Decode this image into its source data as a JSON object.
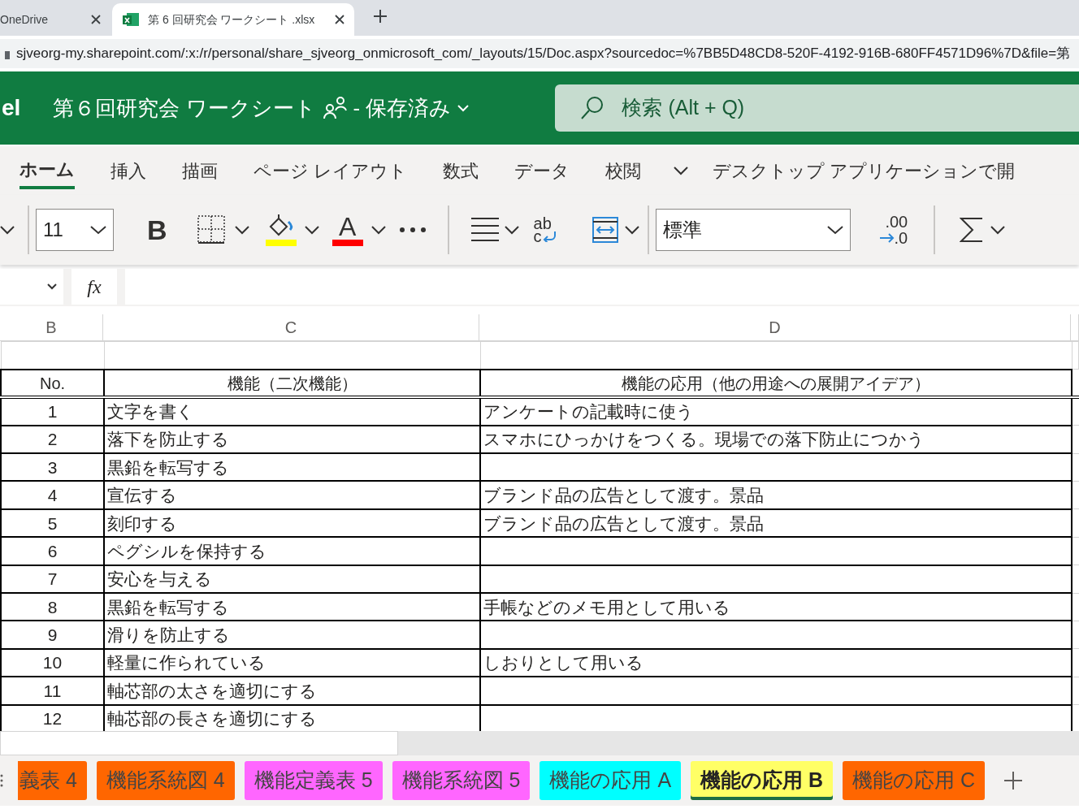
{
  "browser_tabs": [
    {
      "title": "OneDrive",
      "selected": false
    },
    {
      "title": "第 6 回研究会 ワークシート .xlsx",
      "selected": true
    }
  ],
  "address": "sjveorg-my.sharepoint.com/:x:/r/personal/share_sjveorg_onmicrosoft_com/_layouts/15/Doc.aspx?sourcedoc=%7BB5D48CD8-520F-4192-916B-680FF4571D96%7D&file=第",
  "app_header": {
    "logo_text": "el",
    "document_title": "第６回研究会 ワークシート",
    "save_status": "- 保存済み",
    "search_placeholder": "検索 (Alt + Q)"
  },
  "ribbon_tabs": [
    {
      "label": "ホーム",
      "selected": true
    },
    {
      "label": "挿入",
      "selected": false
    },
    {
      "label": "描画",
      "selected": false
    },
    {
      "label": "ページ レイアウト",
      "selected": false
    },
    {
      "label": "数式",
      "selected": false
    },
    {
      "label": "データ",
      "selected": false
    },
    {
      "label": "校閲",
      "selected": false
    }
  ],
  "open_in_desktop": "デスクトップ アプリケーションで開",
  "toolbar": {
    "font_size": "11",
    "bold": "B",
    "font_color_letter": "A",
    "wrap_text": [
      "ab",
      "c"
    ],
    "number_format": "標準",
    "decimal": [
      ".00",
      ".0"
    ]
  },
  "formula_bar": {
    "fx": "fx"
  },
  "columns": [
    "B",
    "C",
    "D"
  ],
  "table": {
    "header": [
      "No.",
      "機能（二次機能）",
      "機能の応用（他の用途への展開アイデア）"
    ],
    "rows": [
      [
        "1",
        "文字を書く",
        "アンケートの記載時に使う"
      ],
      [
        "2",
        "落下を防止する",
        "スマホにひっかけをつくる。現場での落下防止につかう"
      ],
      [
        "3",
        "黒鉛を転写する",
        ""
      ],
      [
        "4",
        "宣伝する",
        "ブランド品の広告として渡す。景品"
      ],
      [
        "5",
        "刻印する",
        "ブランド品の広告として渡す。景品"
      ],
      [
        "6",
        "ペグシルを保持する",
        ""
      ],
      [
        "7",
        "安心を与える",
        ""
      ],
      [
        "8",
        "黒鉛を転写する",
        "手帳などのメモ用として用いる"
      ],
      [
        "9",
        "滑りを防止する",
        ""
      ],
      [
        "10",
        "軽量に作られている",
        "しおりとして用いる"
      ],
      [
        "11",
        "軸芯部の太さを適切にする",
        ""
      ],
      [
        "12",
        "軸芯部の長さを適切にする",
        ""
      ]
    ]
  },
  "sheet_tabs": [
    {
      "label": "義表 4",
      "color": "#ff6600",
      "selected": false
    },
    {
      "label": "機能系統図 4",
      "color": "#ff6600",
      "selected": false
    },
    {
      "label": "機能定義表 5",
      "color": "#ff66ff",
      "selected": false
    },
    {
      "label": "機能系統図 5",
      "color": "#ff66ff",
      "selected": false
    },
    {
      "label": "機能の応用 A",
      "color": "#00ffff",
      "selected": false
    },
    {
      "label": "機能の応用 B",
      "color": "#ffff66",
      "selected": true
    },
    {
      "label": "機能の応用 C",
      "color": "#ff6600",
      "selected": false
    }
  ]
}
